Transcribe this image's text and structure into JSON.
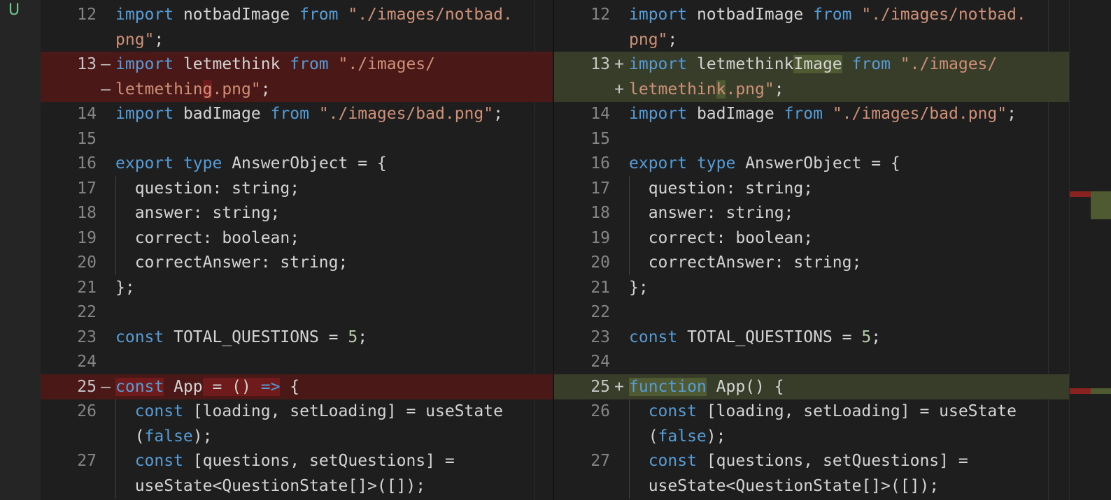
{
  "scm_badge": "U",
  "colors": {
    "deleted_line": "#4b1818",
    "inserted_line": "#373d29",
    "keyword": "#569cd6",
    "string": "#ce9178",
    "number": "#b5cea8"
  },
  "left": {
    "rows": [
      {
        "ln": "12",
        "mark": "",
        "kind": "",
        "tokens": [
          {
            "t": "import",
            "c": "kw"
          },
          {
            "t": " notbadImage "
          },
          {
            "t": "from",
            "c": "kw"
          },
          {
            "t": " "
          },
          {
            "t": "\"./images/notbad.",
            "c": "str"
          }
        ]
      },
      {
        "ln": "",
        "mark": "",
        "kind": "",
        "tokens": [
          {
            "t": "png\"",
            "c": "str"
          },
          {
            "t": ";"
          }
        ]
      },
      {
        "ln": "13",
        "mark": "—",
        "kind": "del",
        "tokens": [
          {
            "t": "import",
            "c": "kw"
          },
          {
            "t": " letmethink "
          },
          {
            "t": "from",
            "c": "kw"
          },
          {
            "t": " "
          },
          {
            "t": "\"./images/",
            "c": "str"
          }
        ]
      },
      {
        "ln": "",
        "mark": "—",
        "kind": "del",
        "tokens": [
          {
            "t": "letmethin",
            "c": "str"
          },
          {
            "t": "g",
            "c": "str hl-del"
          },
          {
            "t": ".png\"",
            "c": "str"
          },
          {
            "t": ";"
          }
        ]
      },
      {
        "ln": "14",
        "mark": "",
        "kind": "",
        "tokens": [
          {
            "t": "import",
            "c": "kw"
          },
          {
            "t": " badImage "
          },
          {
            "t": "from",
            "c": "kw"
          },
          {
            "t": " "
          },
          {
            "t": "\"./images/bad.png\"",
            "c": "str"
          },
          {
            "t": ";"
          }
        ]
      },
      {
        "ln": "15",
        "mark": "",
        "kind": "",
        "tokens": []
      },
      {
        "ln": "16",
        "mark": "",
        "kind": "",
        "tokens": [
          {
            "t": "export",
            "c": "kw"
          },
          {
            "t": " "
          },
          {
            "t": "type",
            "c": "kw"
          },
          {
            "t": " AnswerObject = {"
          }
        ]
      },
      {
        "ln": "17",
        "mark": "",
        "kind": "",
        "indent": true,
        "tokens": [
          {
            "t": "  question: string;"
          }
        ]
      },
      {
        "ln": "18",
        "mark": "",
        "kind": "",
        "indent": true,
        "tokens": [
          {
            "t": "  answer: string;"
          }
        ]
      },
      {
        "ln": "19",
        "mark": "",
        "kind": "",
        "indent": true,
        "tokens": [
          {
            "t": "  correct: boolean;"
          }
        ]
      },
      {
        "ln": "20",
        "mark": "",
        "kind": "",
        "indent": true,
        "tokens": [
          {
            "t": "  correctAnswer: string;"
          }
        ]
      },
      {
        "ln": "21",
        "mark": "",
        "kind": "",
        "tokens": [
          {
            "t": "};"
          }
        ]
      },
      {
        "ln": "22",
        "mark": "",
        "kind": "",
        "tokens": []
      },
      {
        "ln": "23",
        "mark": "",
        "kind": "",
        "tokens": [
          {
            "t": "const",
            "c": "kw"
          },
          {
            "t": " TOTAL_QUESTIONS = "
          },
          {
            "t": "5",
            "c": "num"
          },
          {
            "t": ";"
          }
        ]
      },
      {
        "ln": "24",
        "mark": "",
        "kind": "",
        "tokens": []
      },
      {
        "ln": "25",
        "mark": "—",
        "kind": "del",
        "tokens": [
          {
            "t": "const",
            "c": "kw hl-del"
          },
          {
            "t": " App"
          },
          {
            "t": " = () ",
            "c": "hl-del"
          },
          {
            "t": "=>",
            "c": "kw hl-del"
          },
          {
            "t": " {"
          }
        ]
      },
      {
        "ln": "26",
        "mark": "",
        "kind": "",
        "indent": true,
        "tokens": [
          {
            "t": "  "
          },
          {
            "t": "const",
            "c": "kw"
          },
          {
            "t": " [loading, setLoading] = useState"
          }
        ]
      },
      {
        "ln": "",
        "mark": "",
        "kind": "",
        "indent": true,
        "tokens": [
          {
            "t": "  ("
          },
          {
            "t": "false",
            "c": "kw"
          },
          {
            "t": ");"
          }
        ]
      },
      {
        "ln": "27",
        "mark": "",
        "kind": "",
        "indent": true,
        "tokens": [
          {
            "t": "  "
          },
          {
            "t": "const",
            "c": "kw"
          },
          {
            "t": " [questions, setQuestions] ="
          }
        ]
      },
      {
        "ln": "",
        "mark": "",
        "kind": "",
        "indent": true,
        "tokens": [
          {
            "t": "  useState<QuestionState[]>([]);"
          }
        ]
      }
    ]
  },
  "right": {
    "rows": [
      {
        "ln": "12",
        "mark": "",
        "kind": "",
        "tokens": [
          {
            "t": "import",
            "c": "kw"
          },
          {
            "t": " notbadImage "
          },
          {
            "t": "from",
            "c": "kw"
          },
          {
            "t": " "
          },
          {
            "t": "\"./images/notbad.",
            "c": "str"
          }
        ]
      },
      {
        "ln": "",
        "mark": "",
        "kind": "",
        "tokens": [
          {
            "t": "png\"",
            "c": "str"
          },
          {
            "t": ";"
          }
        ]
      },
      {
        "ln": "13",
        "mark": "+",
        "kind": "add",
        "tokens": [
          {
            "t": "import",
            "c": "kw"
          },
          {
            "t": " letmethink"
          },
          {
            "t": "Image",
            "c": "hl-add"
          },
          {
            "t": " "
          },
          {
            "t": "from",
            "c": "kw"
          },
          {
            "t": " "
          },
          {
            "t": "\"./images/",
            "c": "str"
          }
        ]
      },
      {
        "ln": "",
        "mark": "+",
        "kind": "add",
        "tokens": [
          {
            "t": "letmethin",
            "c": "str"
          },
          {
            "t": "k",
            "c": "str hl-add"
          },
          {
            "t": ".png\"",
            "c": "str"
          },
          {
            "t": ";"
          }
        ]
      },
      {
        "ln": "14",
        "mark": "",
        "kind": "",
        "tokens": [
          {
            "t": "import",
            "c": "kw"
          },
          {
            "t": " badImage "
          },
          {
            "t": "from",
            "c": "kw"
          },
          {
            "t": " "
          },
          {
            "t": "\"./images/bad.png\"",
            "c": "str"
          },
          {
            "t": ";"
          }
        ]
      },
      {
        "ln": "15",
        "mark": "",
        "kind": "",
        "tokens": []
      },
      {
        "ln": "16",
        "mark": "",
        "kind": "",
        "tokens": [
          {
            "t": "export",
            "c": "kw"
          },
          {
            "t": " "
          },
          {
            "t": "type",
            "c": "kw"
          },
          {
            "t": " AnswerObject = {"
          }
        ]
      },
      {
        "ln": "17",
        "mark": "",
        "kind": "",
        "indent": true,
        "tokens": [
          {
            "t": "  question: string;"
          }
        ]
      },
      {
        "ln": "18",
        "mark": "",
        "kind": "",
        "indent": true,
        "tokens": [
          {
            "t": "  answer: string;"
          }
        ]
      },
      {
        "ln": "19",
        "mark": "",
        "kind": "",
        "indent": true,
        "tokens": [
          {
            "t": "  correct: boolean;"
          }
        ]
      },
      {
        "ln": "20",
        "mark": "",
        "kind": "",
        "indent": true,
        "tokens": [
          {
            "t": "  correctAnswer: string;"
          }
        ]
      },
      {
        "ln": "21",
        "mark": "",
        "kind": "",
        "tokens": [
          {
            "t": "};"
          }
        ]
      },
      {
        "ln": "22",
        "mark": "",
        "kind": "",
        "tokens": []
      },
      {
        "ln": "23",
        "mark": "",
        "kind": "",
        "tokens": [
          {
            "t": "const",
            "c": "kw"
          },
          {
            "t": " TOTAL_QUESTIONS = "
          },
          {
            "t": "5",
            "c": "num"
          },
          {
            "t": ";"
          }
        ]
      },
      {
        "ln": "24",
        "mark": "",
        "kind": "",
        "tokens": []
      },
      {
        "ln": "25",
        "mark": "+",
        "kind": "add",
        "tokens": [
          {
            "t": "function",
            "c": "kw hl-add"
          },
          {
            "t": " App() {"
          }
        ]
      },
      {
        "ln": "26",
        "mark": "",
        "kind": "",
        "indent": true,
        "tokens": [
          {
            "t": "  "
          },
          {
            "t": "const",
            "c": "kw"
          },
          {
            "t": " [loading, setLoading] = useState"
          }
        ]
      },
      {
        "ln": "",
        "mark": "",
        "kind": "",
        "indent": true,
        "tokens": [
          {
            "t": "  ("
          },
          {
            "t": "false",
            "c": "kw"
          },
          {
            "t": ");"
          }
        ]
      },
      {
        "ln": "27",
        "mark": "",
        "kind": "",
        "indent": true,
        "tokens": [
          {
            "t": "  "
          },
          {
            "t": "const",
            "c": "kw"
          },
          {
            "t": " [questions, setQuestions] ="
          }
        ]
      },
      {
        "ln": "",
        "mark": "",
        "kind": "",
        "indent": true,
        "tokens": [
          {
            "t": "  useState<QuestionState[]>([]);"
          }
        ]
      }
    ]
  }
}
